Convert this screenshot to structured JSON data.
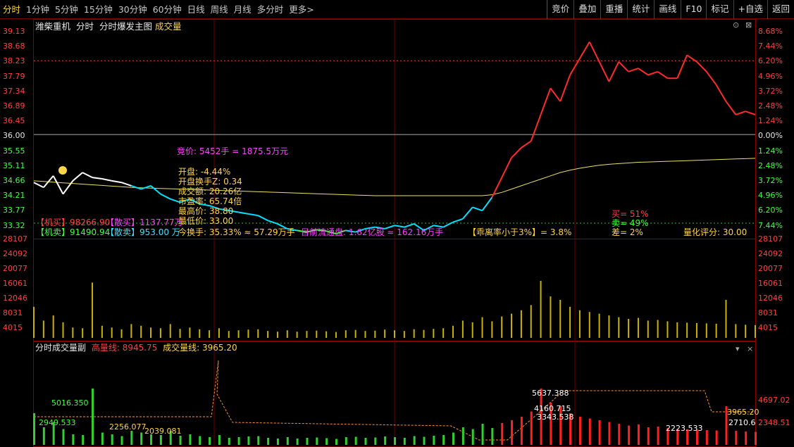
{
  "tabs": [
    "分时",
    "1分钟",
    "5分钟",
    "15分钟",
    "30分钟",
    "60分钟",
    "日线",
    "周线",
    "月线",
    "多分时",
    "更多>"
  ],
  "active_tab": "分时",
  "right_buttons": [
    "竞价",
    "叠加",
    "重播",
    "统计",
    "画线",
    "F10",
    "标记",
    "+自选",
    "返回"
  ],
  "stock_name": "潍柴重机",
  "chart_title": "分时",
  "indicator_name": "分时爆发主图",
  "volume_label": "成交量",
  "price_ticks": [
    "39.13",
    "38.68",
    "38.23",
    "37.79",
    "37.34",
    "36.89",
    "36.45",
    "36.00",
    "35.55",
    "35.11",
    "34.66",
    "34.21",
    "33.77",
    "33.32"
  ],
  "pct_ticks": [
    "8.68%",
    "7.44%",
    "6.20%",
    "4.96%",
    "3.72%",
    "2.48%",
    "1.24%",
    "0.00%",
    "1.24%",
    "2.48%",
    "3.72%",
    "4.96%",
    "6.20%",
    "7.44%"
  ],
  "vol_ticks": [
    "28107",
    "24092",
    "20077",
    "16061",
    "12046",
    "8031",
    "4015"
  ],
  "sub_ticks": [
    "4697.02",
    "2348.51"
  ],
  "info": {
    "auction": "竞价: 5452手 = 1875.5万元",
    "open": "开盘: -4.44%",
    "open_turnover": "开盘换手Z: 0.34",
    "amount": "成交额: 20.26亿",
    "pe": "市盈率: 65.74倍",
    "high": "最高价: 38.80",
    "low": "最低价: 33.00",
    "turnover": "今换手: 35.33% ≈ 57.29万手",
    "float_shares": "目前流通盘: 1.62亿股 ≈ 162.16万手",
    "inst_buy": "【机买】98266.90",
    "retail_buy": "【散买】1137.77万",
    "inst_sell": "【机卖】91490.94",
    "retail_sell": "【散卖】953.00 万",
    "deviation": "【乖离率小于3%】= 3.8%",
    "buy_pct": "买= 51%",
    "sell_pct": "卖= 49%",
    "diff_pct": "差= 2%",
    "score": "量化评分: 30.00"
  },
  "sub_panel": {
    "title": "分时成交量副",
    "high_line": "高量线: 8945.75",
    "vol_line": "成交量线: 3965.20",
    "labels": [
      "5016.350",
      "2949.533",
      "2256.077",
      "2039.081",
      "5637.388",
      "4160.715",
      "3343.538",
      "2223.533",
      "3965.20",
      "2710.6"
    ]
  },
  "chart_data": {
    "type": "line",
    "title": "",
    "prev_close": 36.0,
    "ylim": [
      33.32,
      39.13
    ],
    "price": [
      34.55,
      34.4,
      34.75,
      34.2,
      34.6,
      34.85,
      34.7,
      34.66,
      34.6,
      34.55,
      34.45,
      34.35,
      34.45,
      34.2,
      34.05,
      33.95,
      34.05,
      33.9,
      33.85,
      33.75,
      33.7,
      33.65,
      33.6,
      33.55,
      33.4,
      33.3,
      33.15,
      33.1,
      33.05,
      33.12,
      33.08,
      33.0,
      33.1,
      33.05,
      33.15,
      33.2,
      33.15,
      33.25,
      33.2,
      33.3,
      33.1,
      33.25,
      33.2,
      33.35,
      33.45,
      33.8,
      33.7,
      34.1,
      34.7,
      35.3,
      35.6,
      35.8,
      36.6,
      37.4,
      37.0,
      37.8,
      38.3,
      38.8,
      38.2,
      37.6,
      38.2,
      37.9,
      38.0,
      37.8,
      37.9,
      37.7,
      37.7,
      38.4,
      38.2,
      37.9,
      37.5,
      37.0,
      36.6,
      36.7,
      36.6
    ],
    "avg": [
      34.6,
      34.58,
      34.56,
      34.54,
      34.52,
      34.5,
      34.48,
      34.46,
      34.44,
      34.42,
      34.4,
      34.39,
      34.38,
      34.37,
      34.36,
      34.35,
      34.34,
      34.33,
      34.32,
      34.31,
      34.3,
      34.29,
      34.28,
      34.27,
      34.26,
      34.25,
      34.24,
      34.23,
      34.22,
      34.21,
      34.2,
      34.19,
      34.18,
      34.17,
      34.16,
      34.15,
      34.15,
      34.15,
      34.15,
      34.15,
      34.15,
      34.15,
      34.15,
      34.15,
      34.15,
      34.15,
      34.15,
      34.18,
      34.25,
      34.35,
      34.45,
      34.55,
      34.65,
      34.75,
      34.85,
      34.92,
      34.98,
      35.03,
      35.07,
      35.1,
      35.12,
      35.14,
      35.16,
      35.17,
      35.18,
      35.19,
      35.2,
      35.21,
      35.22,
      35.23,
      35.24,
      35.25,
      35.26,
      35.27,
      35.28
    ],
    "volume": [
      9000,
      5000,
      6500,
      4500,
      3000,
      2800,
      16000,
      3500,
      3000,
      2500,
      4000,
      3500,
      3000,
      2800,
      4000,
      2600,
      3000,
      2500,
      2200,
      2800,
      2000,
      2200,
      2400,
      2500,
      2000,
      1800,
      2200,
      1800,
      2000,
      2100,
      1900,
      1700,
      2200,
      2300,
      2000,
      2100,
      2400,
      2200,
      2000,
      2500,
      2300,
      2600,
      2800,
      3500,
      5000,
      4500,
      6000,
      4800,
      6200,
      7000,
      8000,
      9500,
      16500,
      12000,
      11000,
      9000,
      8000,
      7500,
      7000,
      6500,
      6000,
      5500,
      5800,
      5000,
      5200,
      4800,
      4500,
      4400,
      4300,
      4200,
      4100,
      11000,
      4000,
      3800,
      3700
    ]
  },
  "colors": {
    "up": "#ff2a2a",
    "down": "#00e0ff",
    "avg": "#f0e060",
    "border": "#8b0000",
    "yellow": "#ffd54a",
    "magenta": "#ff40ff"
  }
}
